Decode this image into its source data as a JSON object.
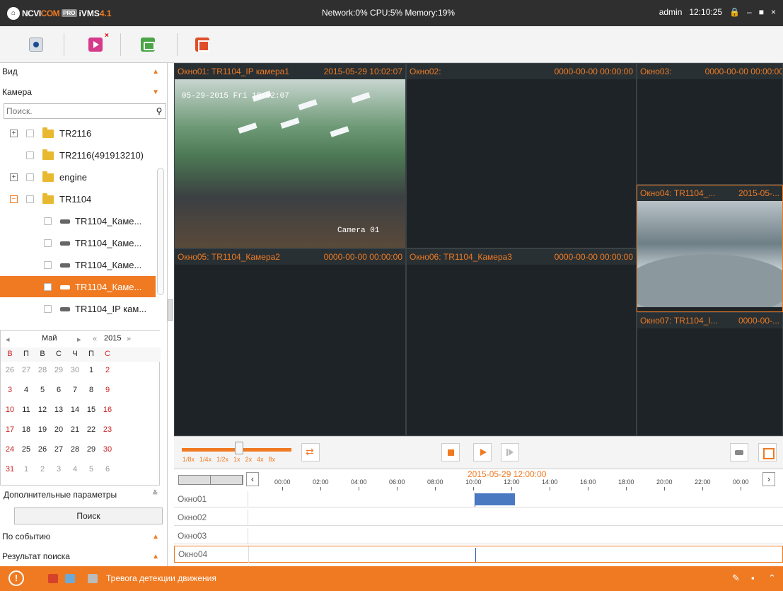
{
  "titlebar": {
    "brand_pre": "NCVI",
    "brand_mid": "COM",
    "pro": "PRO",
    "product": "iVMS",
    "version": "4.1",
    "sysinfo": "Network:0% CPU:5% Memory:19%",
    "user": "admin",
    "time": "12:10:25"
  },
  "left": {
    "view_label": "Вид",
    "camera_label": "Камера",
    "search_placeholder": "Поиск.",
    "tree": [
      {
        "label": "TR2116"
      },
      {
        "label": "TR2116(491913210)"
      },
      {
        "label": "engine"
      },
      {
        "label": "TR1104"
      },
      {
        "label": "TR1104_Каме..."
      },
      {
        "label": "TR1104_Каме..."
      },
      {
        "label": "TR1104_Каме..."
      },
      {
        "label": "TR1104_Каме..."
      },
      {
        "label": "TR1104_IP кам..."
      }
    ],
    "calendar": {
      "month": "Май",
      "year": "2015",
      "dow": [
        "В",
        "П",
        "В",
        "С",
        "Ч",
        "П",
        "С"
      ],
      "weeks": [
        [
          "26",
          "27",
          "28",
          "29",
          "30",
          "1",
          "2"
        ],
        [
          "3",
          "4",
          "5",
          "6",
          "7",
          "8",
          "9"
        ],
        [
          "10",
          "11",
          "12",
          "13",
          "14",
          "15",
          "16"
        ],
        [
          "17",
          "18",
          "19",
          "20",
          "21",
          "22",
          "23"
        ],
        [
          "24",
          "25",
          "26",
          "27",
          "28",
          "29",
          "30"
        ],
        [
          "31",
          "1",
          "2",
          "3",
          "4",
          "5",
          "6"
        ]
      ]
    },
    "advanced_label": "Дополнительные параметры",
    "search_button": "Поиск",
    "by_event_label": "По событию",
    "results_label": "Результат поиска"
  },
  "windows": [
    {
      "title": "Окно01: TR1104_IP камера1",
      "time": "2015-05-29 10:02:07",
      "osd_time": "05-29-2015 Fri 10:02:07",
      "osd_name": "Camera 01"
    },
    {
      "title": "Окно02:",
      "time": "0000-00-00 00:00:00"
    },
    {
      "title": "Окно03:",
      "time": "0000-00-00 00:00:00"
    },
    {
      "title": "Окно04: TR1104_...",
      "time": "2015-05-..."
    },
    {
      "title": "Окно05: TR1104_Камера2",
      "time": "0000-00-00 00:00:00"
    },
    {
      "title": "Окно06: TR1104_Камера3",
      "time": "0000-00-00 00:00:00"
    },
    {
      "title": "Окно07: TR1104_I...",
      "time": "0000-00-..."
    }
  ],
  "controls": {
    "speeds": [
      "1/8x",
      "1/4x",
      "1/2x",
      "1x",
      "2x",
      "4x",
      "8x"
    ]
  },
  "timeline": {
    "date": "2015-05-29 12:00:00",
    "ticks": [
      "00:00",
      "02:00",
      "04:00",
      "06:00",
      "08:00",
      "10:00",
      "12:00",
      "14:00",
      "16:00",
      "18:00",
      "20:00",
      "22:00",
      "00:00"
    ],
    "rows": [
      "Окно01",
      "Окно02",
      "Окно03",
      "Окно04"
    ]
  },
  "status": {
    "alarm_text": "Тревога детекции движения"
  },
  "colors": {
    "accent": "#f07a22",
    "titlebar": "#2f2f2f",
    "video_bg": "#1d2326",
    "record_bar": "#4a79c2"
  }
}
